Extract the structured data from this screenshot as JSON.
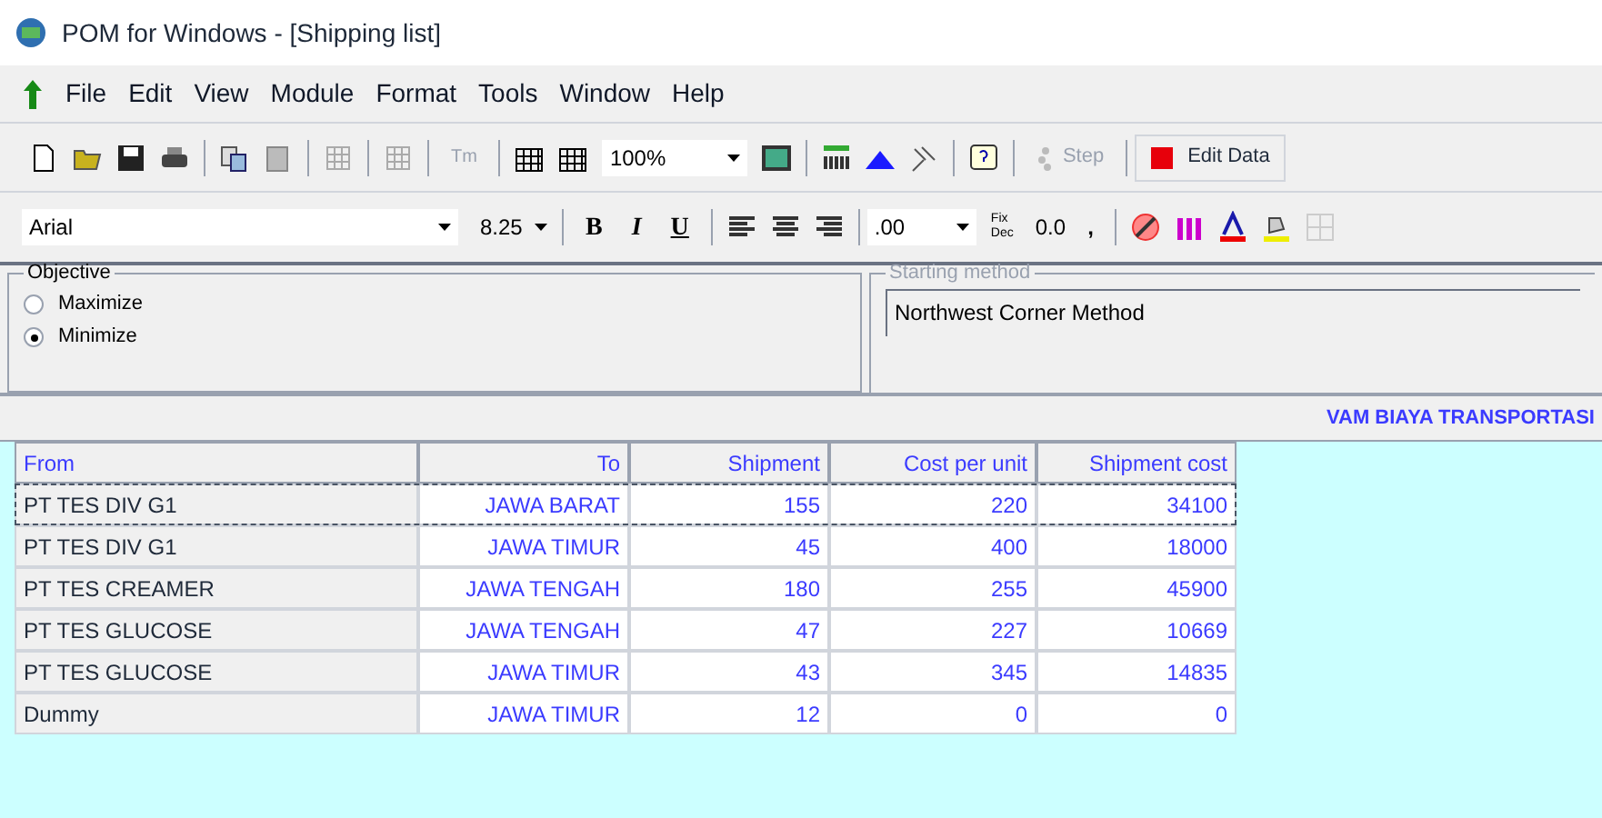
{
  "window": {
    "title": "POM for Windows - [Shipping list]"
  },
  "menu": [
    "File",
    "Edit",
    "View",
    "Module",
    "Format",
    "Tools",
    "Window",
    "Help"
  ],
  "toolbar": {
    "zoom": "100%",
    "tm": "Tm",
    "step": "Step",
    "edit_data": "Edit Data"
  },
  "format_bar": {
    "font": "Arial",
    "size": "8.25",
    "bold": "B",
    "italic": "I",
    "underline": "U",
    "decimals": ".00",
    "fix": "Fix",
    "dec": "Dec",
    "zero": "0.0",
    "comma": ","
  },
  "objective": {
    "title": "Objective",
    "options": [
      {
        "label": "Maximize",
        "selected": false
      },
      {
        "label": "Minimize",
        "selected": true
      }
    ]
  },
  "starting_method": {
    "title": "Starting method",
    "value": "Northwest Corner Method"
  },
  "banner": "VAM BIAYA TRANSPORTASI",
  "table": {
    "columns": [
      "From",
      "To",
      "Shipment",
      "Cost per unit",
      "Shipment cost"
    ],
    "rows": [
      {
        "cells": [
          "PT TES DIV G1",
          "JAWA BARAT",
          "155",
          "220",
          "34100"
        ],
        "selected": true
      },
      {
        "cells": [
          "PT TES DIV G1",
          "JAWA TIMUR",
          "45",
          "400",
          "18000"
        ],
        "selected": false
      },
      {
        "cells": [
          "PT TES CREAMER",
          "JAWA TENGAH",
          "180",
          "255",
          "45900"
        ],
        "selected": false
      },
      {
        "cells": [
          "PT TES GLUCOSE",
          "JAWA TENGAH",
          "47",
          "227",
          "10669"
        ],
        "selected": false
      },
      {
        "cells": [
          "PT TES GLUCOSE",
          "JAWA TIMUR",
          "43",
          "345",
          "14835"
        ],
        "selected": false
      },
      {
        "cells": [
          "Dummy",
          "JAWA TIMUR",
          "12",
          "0",
          "0"
        ],
        "selected": false
      }
    ]
  }
}
